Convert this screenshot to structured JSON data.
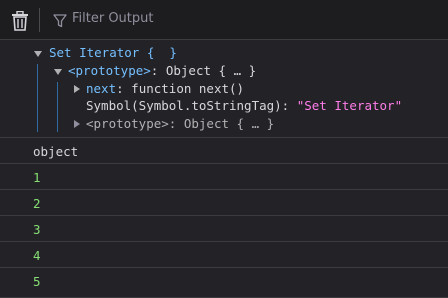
{
  "toolbar": {
    "filter_placeholder": "Filter Output",
    "clear_icon": "trash-icon",
    "filter_icon": "filter-icon"
  },
  "tree": {
    "root": {
      "text": "Set Iterator {  }"
    },
    "prototype": {
      "key": "<prototype>",
      "sep": ": ",
      "value": "Object { … }"
    },
    "next": {
      "key": "next",
      "sep": ": ",
      "value": "function next()"
    },
    "tostringtag": {
      "key": "Symbol(Symbol.toStringTag)",
      "sep": ": ",
      "value": "\"Set Iterator\""
    },
    "inner_prototype": {
      "key": "<prototype>",
      "sep": ": ",
      "value": "Object { … }"
    }
  },
  "output_rows": [
    {
      "text": "object",
      "kind": "string"
    },
    {
      "text": "1",
      "kind": "number"
    },
    {
      "text": "2",
      "kind": "number"
    },
    {
      "text": "3",
      "kind": "number"
    },
    {
      "text": "4",
      "kind": "number"
    },
    {
      "text": "5",
      "kind": "number"
    }
  ],
  "colors": {
    "background": "#232327",
    "toolbar": "#1d1d20",
    "key_blue": "#75bfff",
    "string_pink": "#ff7de9",
    "number_green": "#86de74",
    "text": "#d7d7db"
  }
}
